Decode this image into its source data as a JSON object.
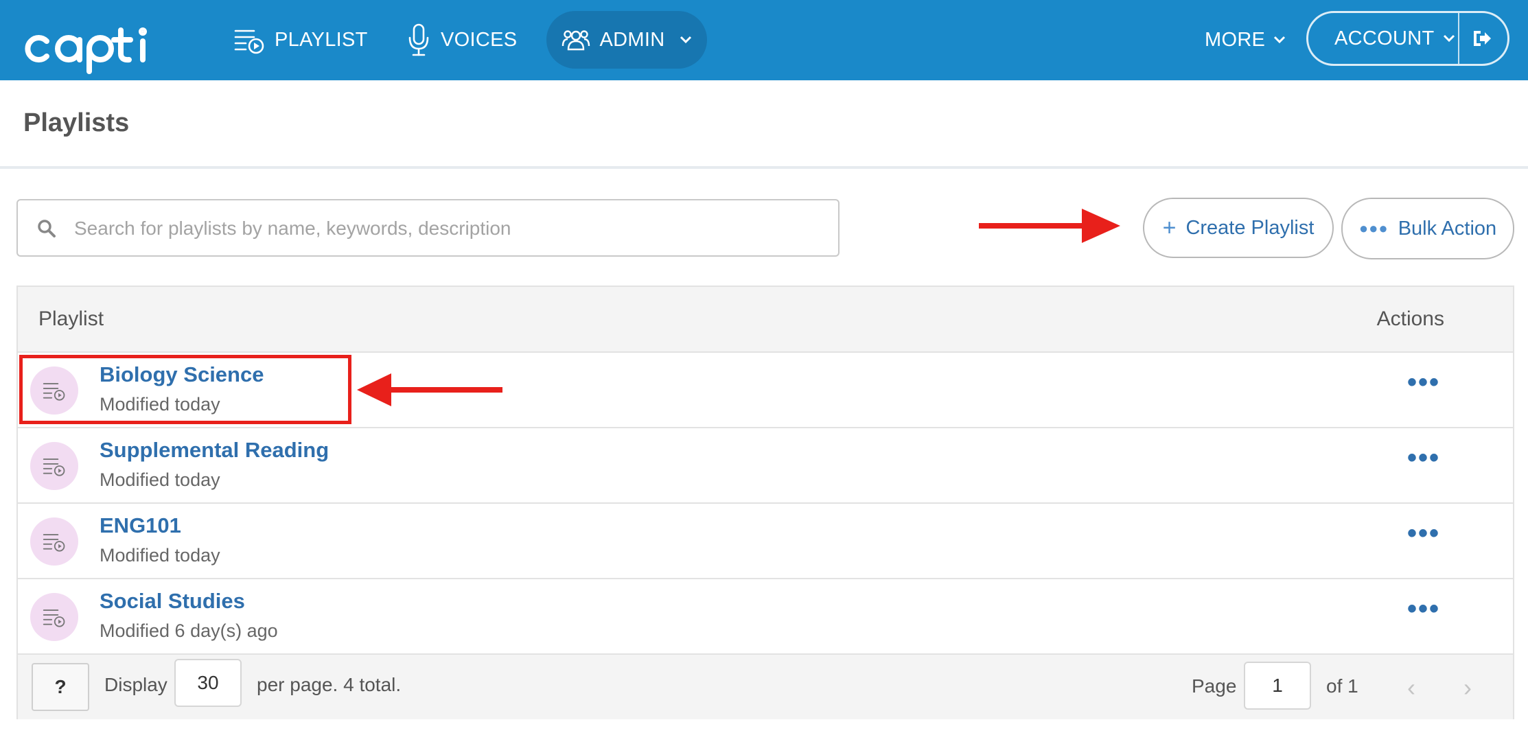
{
  "brand": {
    "logo_text": "capti"
  },
  "nav": {
    "playlist": "PLAYLIST",
    "voices": "VOICES",
    "admin": "ADMIN",
    "more": "MORE",
    "account": "ACCOUNT"
  },
  "page": {
    "title": "Playlists"
  },
  "search": {
    "placeholder": "Search for playlists by name, keywords, description",
    "value": ""
  },
  "toolbar": {
    "create_label": "Create Playlist",
    "bulk_label": "Bulk Action"
  },
  "table": {
    "headers": {
      "playlist": "Playlist",
      "actions": "Actions"
    },
    "rows": [
      {
        "title": "Biology Science",
        "modified": "Modified today"
      },
      {
        "title": "Supplemental Reading",
        "modified": "Modified today"
      },
      {
        "title": "ENG101",
        "modified": "Modified today"
      },
      {
        "title": "Social Studies",
        "modified": "Modified 6 day(s) ago"
      }
    ],
    "actions_glyph": "•••"
  },
  "footer": {
    "help": "?",
    "display_label": "Display",
    "per_page": "30",
    "per_page_suffix": "per page. 4 total.",
    "page_label": "Page",
    "page_value": "1",
    "of_label": "of 1"
  },
  "colors": {
    "navbar": "#1a89c9",
    "link": "#2f6fad",
    "annotation": "#e8201b",
    "row_icon_bg": "#f2dcf2"
  },
  "icons": {
    "nav_playlist": "playlist-icon",
    "nav_voices": "microphone-icon",
    "nav_admin": "users-icon",
    "logout": "logout-icon",
    "search": "search-icon",
    "row": "playlist-icon"
  }
}
